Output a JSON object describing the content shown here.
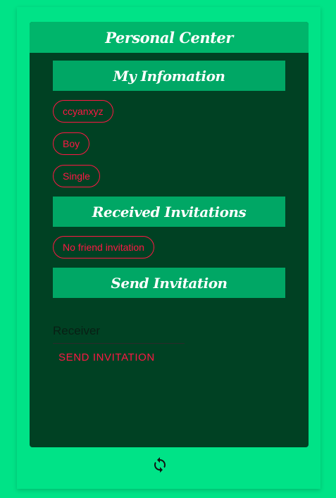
{
  "header": {
    "title": "Personal Center"
  },
  "sections": {
    "info_title": "My Infomation",
    "received_title": "Received Invitations",
    "send_title": "Send Invitation"
  },
  "info": {
    "username": "ccyanxyz",
    "gender": "Boy",
    "status": "Single"
  },
  "received": {
    "empty_label": "No friend invitation"
  },
  "send": {
    "receiver_placeholder": "Receiver",
    "button_label": "SEND INVITATION"
  },
  "footer": {
    "refresh_icon": "refresh-icon"
  },
  "colors": {
    "background": "#00e387",
    "card": "#004123",
    "header": "#00b56b",
    "section_bar": "#00a765",
    "accent": "#ff1744"
  }
}
